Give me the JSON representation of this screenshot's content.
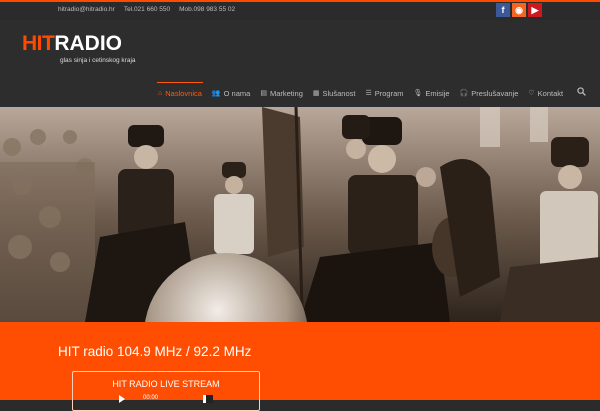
{
  "topbar": {
    "email": "hitradio@hitradio.hr",
    "phone": "Tel.021 660 550",
    "mobile": "Mob.098 983 55 02",
    "social": [
      {
        "icon": "facebook-icon",
        "glyph": "f"
      },
      {
        "icon": "rss-icon",
        "glyph": "◉"
      },
      {
        "icon": "youtube-icon",
        "glyph": "▶"
      }
    ]
  },
  "logo": {
    "hit": "HIT",
    "radio": "RADIO",
    "tagline": "glas sinja i cetinskog kraja"
  },
  "nav": {
    "items": [
      {
        "label": "Naslovnica",
        "icon": "home-icon",
        "glyph": "⌂"
      },
      {
        "label": "O nama",
        "icon": "users-icon",
        "glyph": "👥"
      },
      {
        "label": "Marketing",
        "icon": "briefcase-icon",
        "glyph": "▤"
      },
      {
        "label": "Slušanost",
        "icon": "chart-icon",
        "glyph": "▦"
      },
      {
        "label": "Program",
        "icon": "list-icon",
        "glyph": "☰"
      },
      {
        "label": "Emisije",
        "icon": "microphone-icon",
        "glyph": "🎙"
      },
      {
        "label": "Preslušavanje",
        "icon": "headphones-icon",
        "glyph": "🎧"
      },
      {
        "label": "Kontakt",
        "icon": "heart-icon",
        "glyph": "♡"
      }
    ]
  },
  "hero": {
    "description": "sepia photo of horsemen in traditional costume"
  },
  "strip": {
    "frequency": "HIT radio 104.9 MHz / 92.2 MHz",
    "player_title": "HIT RADIO LIVE STREAM",
    "player_time": "00:00"
  },
  "colors": {
    "accent": "#ff4a00",
    "header_bg": "#2d2d2d",
    "strip_bg": "#ff4e02"
  }
}
